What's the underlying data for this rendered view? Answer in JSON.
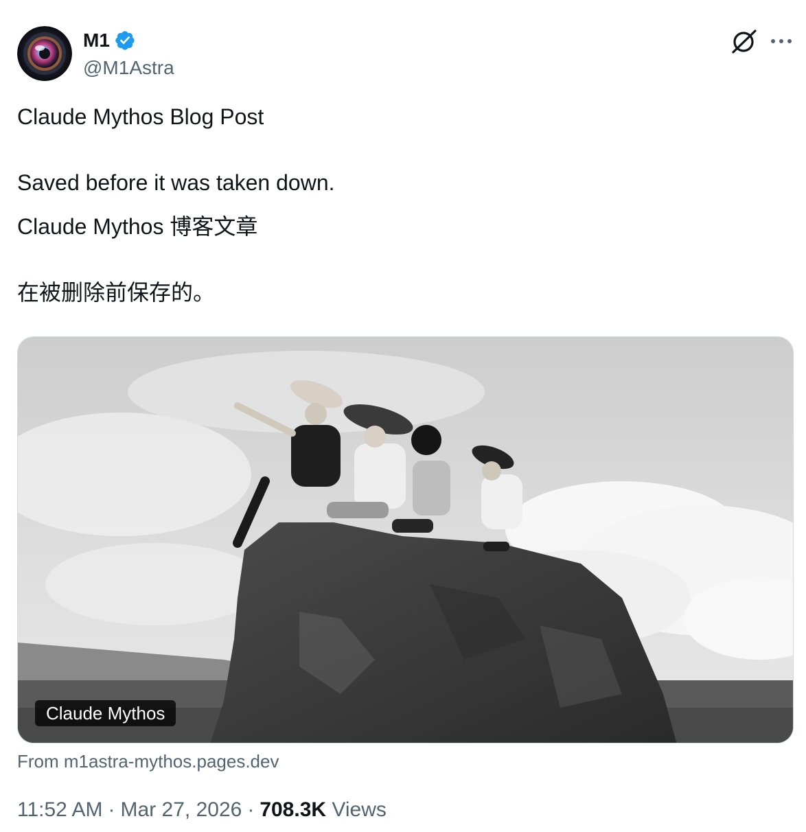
{
  "author": {
    "display_name": "M1",
    "handle": "@M1Astra",
    "verified": true,
    "verified_color": "#1d9bf0",
    "avatar_icon": "camera-lens-avatar"
  },
  "actions": {
    "grok_icon": "grok-icon",
    "more_icon": "more-icon",
    "more_label": "···"
  },
  "tweet": {
    "lines": [
      "Claude Mythos Blog Post",
      "Saved before it was taken down.",
      "Claude Mythos 博客文章",
      "在被删除前保存的。"
    ]
  },
  "card": {
    "title": "Claude Mythos",
    "source": "From m1astra-mythos.pages.dev",
    "image_desc_icon": "children-on-rock-photo"
  },
  "meta": {
    "time": "11:52 AM",
    "date": "Mar 27, 2026",
    "separator": "·",
    "views_count": "708.3K",
    "views_label": "Views"
  },
  "colors": {
    "text_primary": "#0f1419",
    "text_secondary": "#536471",
    "border": "#cfd9de"
  }
}
